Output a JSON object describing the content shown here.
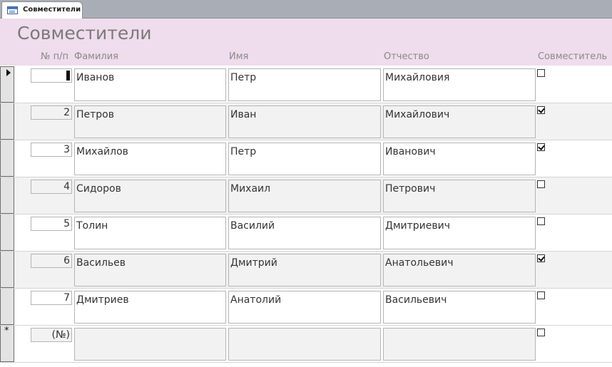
{
  "tab": {
    "title": "Совместители",
    "icon": "form-icon"
  },
  "form": {
    "title": "Совместители",
    "columns": {
      "number": "№ п/п",
      "last_name": "Фамилия",
      "first_name": "Имя",
      "patronymic": "Отчество",
      "part_timer": "Совместитель"
    },
    "records": [
      {
        "number": "1",
        "last_name": "Иванов",
        "first_name": "Петр",
        "patronymic": "Михайловия",
        "part_timer": false
      },
      {
        "number": "2",
        "last_name": "Петров",
        "first_name": "Иван",
        "patronymic": "Михайлович",
        "part_timer": true
      },
      {
        "number": "3",
        "last_name": "Михайлов",
        "first_name": "Петр",
        "patronymic": "Иванович",
        "part_timer": true
      },
      {
        "number": "4",
        "last_name": "Сидоров",
        "first_name": "Михаил",
        "patronymic": "Петрович",
        "part_timer": false
      },
      {
        "number": "5",
        "last_name": "Толин",
        "first_name": "Василий",
        "patronymic": "Дмитриевич",
        "part_timer": false
      },
      {
        "number": "6",
        "last_name": "Васильев",
        "first_name": "Дмитрий",
        "patronymic": "Анатольевич",
        "part_timer": true
      },
      {
        "number": "7",
        "last_name": "Дмитриев",
        "first_name": "Анатолий",
        "patronymic": "Васильевич",
        "part_timer": false
      }
    ],
    "new_record": {
      "number": "(№)",
      "last_name": "",
      "first_name": "",
      "patronymic": "",
      "part_timer": false
    },
    "current_record": "1"
  },
  "colors": {
    "header_bg": "#efdcec",
    "alt_row_bg": "#f2f2f2",
    "tabbar_bg": "#a9aeb6"
  }
}
